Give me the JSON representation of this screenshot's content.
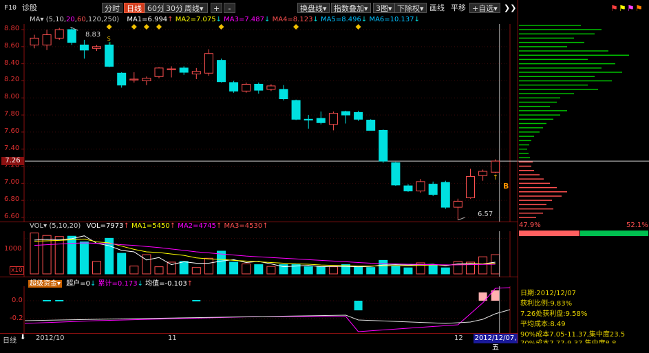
{
  "toolbar": {
    "f10": "F10",
    "stock_name": "诊股",
    "btn_fenshi": "分时",
    "btn_rixian": "日线",
    "btn_60": "60分",
    "btn_30": "30分",
    "btn_zhouxian": "周线",
    "btn_plus": "+",
    "btn_minus": "-",
    "btn_huanpan": "换盘线",
    "btn_zhishu": "指数叠加",
    "btn_3tu": "3图",
    "btn_xiachuquan": "下除权",
    "btn_huaxian": "画线",
    "btn_pingyi": "平移",
    "btn_zixuan": "+自选",
    "btn_expand": "❯❯"
  },
  "ma_legend": {
    "prefix": "MA",
    "params_open": "(5,10,",
    "p20": "20",
    "p60": "60",
    "params_close": ",120,250)",
    "ma1": "MA1=6.994",
    "ma2": "MA2=7.075",
    "ma3": "MA3=7.487",
    "ma4": "MA4=8.123",
    "ma5": "MA5=8.496",
    "ma6": "MA6=10.137"
  },
  "price_axis": [
    "8.80",
    "8.60",
    "8.40",
    "8.20",
    "8.00",
    "7.80",
    "7.60",
    "7.40",
    "7.20",
    "7.00",
    "6.80",
    "6.60"
  ],
  "current_price": "7.26",
  "high_label": "8.83",
  "low_label": "6.57",
  "signal_b": "B",
  "vol_legend": {
    "prefix": "VOL",
    "params": "(5,10,20)",
    "vol": "VOL=7973",
    "ma1": "MA1=5450",
    "ma2": "MA2=4745",
    "ma3": "MA3=4530"
  },
  "vol_axis": {
    "v1000": "1000",
    "unit": "x10"
  },
  "fund_legend": {
    "name": "超级资金",
    "chaohu": "超户=0",
    "leiji": "累计=0.173",
    "junzhi": "均值=-0.103"
  },
  "fund_axis": [
    "0.0",
    "-0.2"
  ],
  "x_axis": {
    "period": "日线",
    "d1": "2012/10",
    "d2": "11",
    "d3": "12",
    "cursor_date": "2012/12/07,五"
  },
  "side": {
    "pct_left": "47.9%",
    "pct_right": "52.1%",
    "date": "日期:2012/12/07",
    "profit_ratio": "获利比例:9.83%",
    "profit_at": "7.26处获利盘:9.58%",
    "avg_cost": "平均成本:8.49",
    "cost90": "90%成本7.05-11.37,集中度23.5",
    "cost70": "70%成本7.77-9.37,集中度8.8"
  },
  "colors": {
    "up": "#ff5050",
    "down": "#00e0e0",
    "axis": "#e03030",
    "ma5": "#ffffff",
    "ma10": "#ffff00",
    "ma20": "#ff00ff",
    "chip": "#00c000"
  },
  "chart_data": {
    "type": "candlestick",
    "candles": [
      {
        "o": 8.62,
        "c": 8.7,
        "h": 8.74,
        "l": 8.58
      },
      {
        "o": 8.62,
        "c": 8.74,
        "h": 8.8,
        "l": 8.56
      },
      {
        "o": 8.7,
        "c": 8.8,
        "h": 8.82,
        "l": 8.68
      },
      {
        "o": 8.8,
        "c": 8.65,
        "h": 8.83,
        "l": 8.62
      },
      {
        "o": 8.62,
        "c": 8.56,
        "h": 8.68,
        "l": 8.46
      },
      {
        "o": 8.58,
        "c": 8.6,
        "h": 8.62,
        "l": 8.55
      },
      {
        "o": 8.62,
        "c": 8.37,
        "h": 8.65,
        "l": 8.36
      },
      {
        "o": 8.29,
        "c": 8.15,
        "h": 8.3,
        "l": 8.12
      },
      {
        "o": 8.21,
        "c": 8.22,
        "h": 8.3,
        "l": 8.18
      },
      {
        "o": 8.2,
        "c": 8.23,
        "h": 8.25,
        "l": 8.15
      },
      {
        "o": 8.25,
        "c": 8.35,
        "h": 8.36,
        "l": 8.23
      },
      {
        "o": 8.33,
        "c": 8.34,
        "h": 8.37,
        "l": 8.24
      },
      {
        "o": 8.35,
        "c": 8.3,
        "h": 8.37,
        "l": 8.27
      },
      {
        "o": 8.28,
        "c": 8.31,
        "h": 8.35,
        "l": 8.22
      },
      {
        "o": 8.29,
        "c": 8.52,
        "h": 8.57,
        "l": 8.26
      },
      {
        "o": 8.44,
        "c": 8.19,
        "h": 8.46,
        "l": 8.18
      },
      {
        "o": 8.18,
        "c": 8.08,
        "h": 8.2,
        "l": 8.06
      },
      {
        "o": 8.08,
        "c": 8.16,
        "h": 8.18,
        "l": 8.06
      },
      {
        "o": 8.16,
        "c": 8.09,
        "h": 8.18,
        "l": 8.05
      },
      {
        "o": 8.1,
        "c": 8.14,
        "h": 8.16,
        "l": 8.08
      },
      {
        "o": 8.1,
        "c": 7.99,
        "h": 8.15,
        "l": 7.97
      },
      {
        "o": 7.97,
        "c": 7.75,
        "h": 7.98,
        "l": 7.74
      },
      {
        "o": 7.75,
        "c": 7.74,
        "h": 7.8,
        "l": 7.64
      },
      {
        "o": 7.76,
        "c": 7.71,
        "h": 7.84,
        "l": 7.69
      },
      {
        "o": 7.69,
        "c": 7.82,
        "h": 7.84,
        "l": 7.62
      },
      {
        "o": 7.84,
        "c": 7.8,
        "h": 7.85,
        "l": 7.7
      },
      {
        "o": 7.83,
        "c": 7.75,
        "h": 7.85,
        "l": 7.73
      },
      {
        "o": 7.74,
        "c": 7.62,
        "h": 7.75,
        "l": 7.62
      },
      {
        "o": 7.62,
        "c": 7.26,
        "h": 7.63,
        "l": 7.24
      },
      {
        "o": 7.24,
        "c": 6.98,
        "h": 7.25,
        "l": 6.97
      },
      {
        "o": 6.97,
        "c": 6.91,
        "h": 6.99,
        "l": 6.9
      },
      {
        "o": 6.91,
        "c": 7.02,
        "h": 7.05,
        "l": 6.89
      },
      {
        "o": 6.99,
        "c": 6.87,
        "h": 7.02,
        "l": 6.85
      },
      {
        "o": 7.01,
        "c": 6.72,
        "h": 7.03,
        "l": 6.7
      },
      {
        "o": 6.72,
        "c": 6.79,
        "h": 6.82,
        "l": 6.57
      },
      {
        "o": 6.83,
        "c": 7.08,
        "h": 7.17,
        "l": 6.82
      },
      {
        "o": 7.09,
        "c": 7.14,
        "h": 7.16,
        "l": 7.03
      },
      {
        "o": 7.13,
        "c": 7.26,
        "h": 7.28,
        "l": 7.12
      }
    ],
    "volume": [
      1150,
      1080,
      1050,
      1060,
      900,
      350,
      1000,
      580,
      220,
      540,
      200,
      330,
      350,
      180,
      440,
      640,
      330,
      280,
      260,
      210,
      260,
      260,
      200,
      200,
      200,
      260,
      190,
      180,
      380,
      220,
      170,
      310,
      240,
      170,
      350,
      330,
      480,
      540
    ],
    "vol_ma5": [
      950,
      970,
      960,
      990,
      1070,
      860,
      790,
      660,
      620,
      390,
      460,
      260,
      340,
      300,
      300,
      360,
      400,
      320,
      350,
      280,
      200,
      220,
      240,
      200,
      210,
      210,
      200,
      210,
      250,
      260,
      250,
      260,
      270,
      230,
      280,
      290,
      280,
      330
    ],
    "vol_ma10": [
      920,
      930,
      940,
      960,
      980,
      900,
      870,
      780,
      690,
      620,
      600,
      560,
      520,
      450,
      420,
      410,
      380,
      360,
      340,
      320,
      300,
      280,
      270,
      250,
      240,
      230,
      220,
      220,
      225,
      230,
      230,
      240,
      250,
      250,
      260,
      270,
      280,
      300
    ],
    "vol_ma20": [
      800,
      820,
      840,
      860,
      870,
      860,
      850,
      820,
      800,
      770,
      740,
      700,
      660,
      620,
      590,
      560,
      530,
      500,
      480,
      460,
      440,
      420,
      400,
      380,
      360,
      340,
      320,
      300,
      290,
      280,
      270,
      265,
      260,
      255,
      255,
      260,
      265,
      270
    ],
    "chips": [
      {
        "p": 8.85,
        "w": 90
      },
      {
        "p": 8.8,
        "w": 120
      },
      {
        "p": 8.75,
        "w": 110
      },
      {
        "p": 8.7,
        "w": 80
      },
      {
        "p": 8.65,
        "w": 95
      },
      {
        "p": 8.6,
        "w": 70
      },
      {
        "p": 8.55,
        "w": 130
      },
      {
        "p": 8.5,
        "w": 160
      },
      {
        "p": 8.45,
        "w": 100
      },
      {
        "p": 8.4,
        "w": 140
      },
      {
        "p": 8.35,
        "w": 120
      },
      {
        "p": 8.3,
        "w": 150
      },
      {
        "p": 8.25,
        "w": 110
      },
      {
        "p": 8.2,
        "w": 135
      },
      {
        "p": 8.15,
        "w": 100
      },
      {
        "p": 8.1,
        "w": 115
      },
      {
        "p": 8.05,
        "w": 80
      },
      {
        "p": 8.0,
        "w": 60
      },
      {
        "p": 7.95,
        "w": 55
      },
      {
        "p": 7.9,
        "w": 45
      },
      {
        "p": 7.85,
        "w": 70
      },
      {
        "p": 7.8,
        "w": 60
      },
      {
        "p": 7.75,
        "w": 50
      },
      {
        "p": 7.7,
        "w": 40
      },
      {
        "p": 7.65,
        "w": 35
      },
      {
        "p": 7.6,
        "w": 30
      },
      {
        "p": 7.55,
        "w": 22
      },
      {
        "p": 7.5,
        "w": 18
      },
      {
        "p": 7.45,
        "w": 15
      },
      {
        "p": 7.4,
        "w": 12
      },
      {
        "p": 7.35,
        "w": 14
      },
      {
        "p": 7.3,
        "w": 16
      },
      {
        "p": 7.25,
        "w": 20
      },
      {
        "p": 7.2,
        "w": 18
      },
      {
        "p": 7.15,
        "w": 22
      },
      {
        "p": 7.1,
        "w": 30
      },
      {
        "p": 7.05,
        "w": 36
      },
      {
        "p": 7.0,
        "w": 45
      },
      {
        "p": 6.95,
        "w": 55
      },
      {
        "p": 6.9,
        "w": 70
      },
      {
        "p": 6.85,
        "w": 62
      },
      {
        "p": 6.8,
        "w": 48
      },
      {
        "p": 6.75,
        "w": 40
      },
      {
        "p": 6.7,
        "w": 50
      },
      {
        "p": 6.65,
        "w": 35
      },
      {
        "p": 6.6,
        "w": 25
      }
    ]
  }
}
